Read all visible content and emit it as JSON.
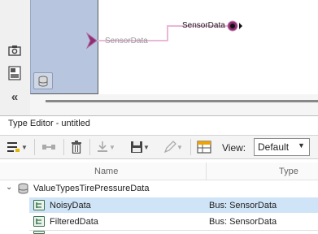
{
  "canvas": {
    "signal_in": "SensorData",
    "signal_out": "SensorData"
  },
  "left_toolbar": {
    "icons": [
      "camera-icon",
      "layers-icon",
      "collapse-left-icon"
    ]
  },
  "type_editor": {
    "title": "Type Editor - untitled",
    "toolbar": {
      "view_label": "View:",
      "view_value": "Default"
    },
    "columns": [
      "Name",
      "Type"
    ],
    "root": {
      "name": "ValueTypesTirePressureData"
    },
    "rows": [
      {
        "name": "NoisyData",
        "type": "Bus: SensorData",
        "selected": true
      },
      {
        "name": "FilteredData",
        "type": "Bus: SensorData",
        "selected": false
      }
    ]
  },
  "colors": {
    "subsystem_block": "#b7c6de",
    "signal_line": "#e9b8d8",
    "port_magenta": "#8e2f74",
    "selected_row": "#cfe4f6"
  }
}
